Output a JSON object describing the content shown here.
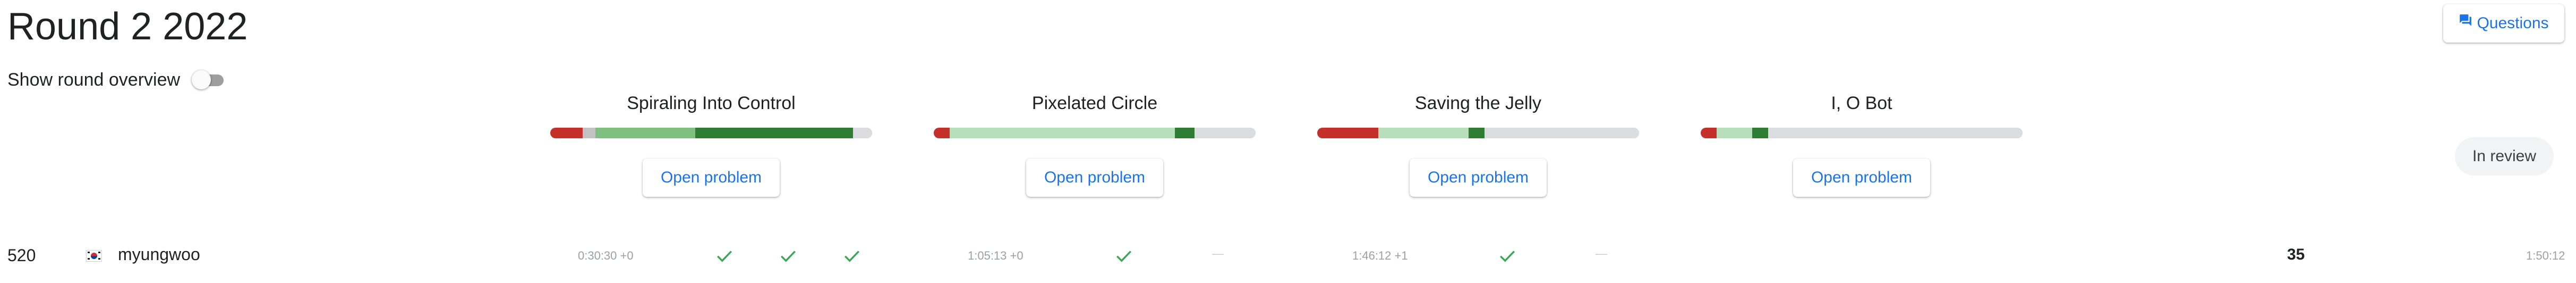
{
  "header": {
    "title": "Round 2 2022",
    "overview_label": "Show round overview",
    "overview_enabled": false
  },
  "questions_button": {
    "label": "Questions",
    "icon": "forum-icon",
    "color": "#1a73e8"
  },
  "status_chip": {
    "label": "In review"
  },
  "problems": [
    {
      "title": "Spiraling Into Control",
      "button_label": "Open problem",
      "distribution": [
        {
          "status": "wrong",
          "fraction": 0.1,
          "color": "#c5302a"
        },
        {
          "status": "other",
          "fraction": 0.04,
          "color": "#c2c2c2"
        },
        {
          "status": "partial",
          "fraction": 0.31,
          "color": "#7fbf7f"
        },
        {
          "status": "full",
          "fraction": 0.49,
          "color": "#2e7d32"
        },
        {
          "status": "unattempted",
          "fraction": 0.06,
          "color": "#dadce0"
        }
      ]
    },
    {
      "title": "Pixelated Circle",
      "button_label": "Open problem",
      "distribution": [
        {
          "status": "wrong",
          "fraction": 0.05,
          "color": "#c5302a"
        },
        {
          "status": "partial",
          "fraction": 0.7,
          "color": "#b7dfb9"
        },
        {
          "status": "full",
          "fraction": 0.06,
          "color": "#2e7d32"
        },
        {
          "status": "unattempted",
          "fraction": 0.19,
          "color": "#dadce0"
        }
      ]
    },
    {
      "title": "Saving the Jelly",
      "button_label": "Open problem",
      "distribution": [
        {
          "status": "wrong",
          "fraction": 0.19,
          "color": "#c5302a"
        },
        {
          "status": "partial",
          "fraction": 0.28,
          "color": "#b7dfb9"
        },
        {
          "status": "full",
          "fraction": 0.05,
          "color": "#2e7d32"
        },
        {
          "status": "unattempted",
          "fraction": 0.48,
          "color": "#dadce0"
        }
      ]
    },
    {
      "title": "I, O Bot",
      "button_label": "Open problem",
      "distribution": [
        {
          "status": "wrong",
          "fraction": 0.05,
          "color": "#c5302a"
        },
        {
          "status": "partial",
          "fraction": 0.11,
          "color": "#b7dfb9"
        },
        {
          "status": "full",
          "fraction": 0.05,
          "color": "#2e7d32"
        },
        {
          "status": "unattempted",
          "fraction": 0.79,
          "color": "#dadce0"
        }
      ]
    }
  ],
  "scoreboard_row": {
    "rank": "520",
    "country_icon": "south-korea-flag-icon",
    "username": "myungwoo",
    "results": [
      {
        "time": "0:30:30 +0",
        "tests": [
          "solved",
          "solved",
          "solved"
        ]
      },
      {
        "time": "1:05:13 +0",
        "tests": [
          "solved",
          "unattempted"
        ]
      },
      {
        "time": "1:46:12 +1",
        "tests": [
          "solved",
          "unattempted"
        ]
      },
      {
        "time": "",
        "tests": []
      }
    ],
    "score": "35",
    "total_time": "1:50:12",
    "unattempted_mark": "—",
    "solved_color": "#34a853"
  }
}
